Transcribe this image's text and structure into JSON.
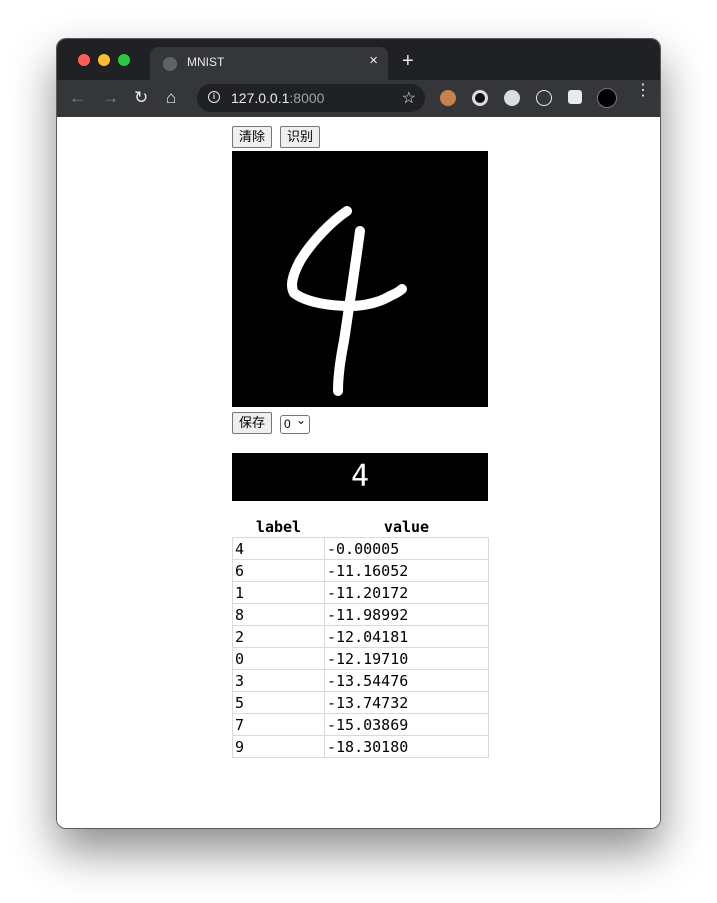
{
  "browser": {
    "tab_title": "MNIST",
    "tab_close": "×",
    "new_tab": "+",
    "url_host": "127.0.0.1",
    "url_port": ":8000",
    "back_glyph": "←",
    "forward_glyph": "→",
    "reload_glyph": "↻",
    "home_glyph": "⌂",
    "bookmark_glyph": "☆",
    "info_glyph": "i",
    "menu_glyph": "⋮",
    "extension_icons": [
      "glasses-extension-icon",
      "circle-extension-icon",
      "moon-extension-icon",
      "react-extension-icon",
      "puzzle-extension-icon",
      "ml-extension-icon"
    ]
  },
  "app": {
    "clear_label": "清除",
    "recognize_label": "识别",
    "save_label": "保存",
    "label_select_value": "0",
    "label_select_arrow": "⌄",
    "canvas_background": "#000000",
    "stroke_color": "#ffffff",
    "prediction": "4",
    "table": {
      "headers": [
        "label",
        "value"
      ],
      "rows": [
        [
          "4",
          "-0.00005"
        ],
        [
          "6",
          "-11.16052"
        ],
        [
          "1",
          "-11.20172"
        ],
        [
          "8",
          "-11.98992"
        ],
        [
          "2",
          "-12.04181"
        ],
        [
          "0",
          "-12.19710"
        ],
        [
          "3",
          "-13.54476"
        ],
        [
          "5",
          "-13.74732"
        ],
        [
          "7",
          "-15.03869"
        ],
        [
          "9",
          "-18.30180"
        ]
      ]
    }
  }
}
